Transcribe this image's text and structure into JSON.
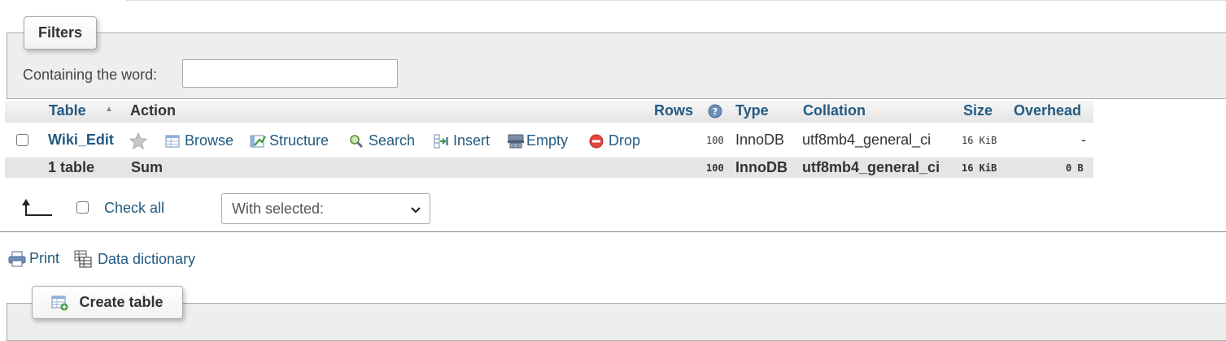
{
  "filters": {
    "legend": "Filters",
    "label": "Containing the word:",
    "value": ""
  },
  "table": {
    "headers": {
      "table": "Table",
      "sort_icon": "▲",
      "action": "Action",
      "rows": "Rows",
      "type": "Type",
      "collation": "Collation",
      "size": "Size",
      "overhead": "Overhead"
    },
    "rows": [
      {
        "name": "Wiki_Edit",
        "actions": {
          "browse": "Browse",
          "structure": "Structure",
          "search": "Search",
          "insert": "Insert",
          "empty": "Empty",
          "drop": "Drop"
        },
        "rows": "100",
        "type": "InnoDB",
        "collation": "utf8mb4_general_ci",
        "size": "16 KiB",
        "overhead": "-"
      }
    ],
    "footer": {
      "count": "1 table",
      "sum": "Sum",
      "rows": "100",
      "type": "InnoDB",
      "collation": "utf8mb4_general_ci",
      "size": "16 KiB",
      "overhead": "0 B"
    }
  },
  "bulk": {
    "check_all": "Check all",
    "with_selected": "With selected:"
  },
  "links": {
    "print": "Print",
    "data_dictionary": "Data dictionary"
  },
  "create": {
    "legend": "Create table"
  },
  "colors": {
    "link": "#235a81",
    "panel": "#eeeeee",
    "drop_red": "#d9534f"
  }
}
